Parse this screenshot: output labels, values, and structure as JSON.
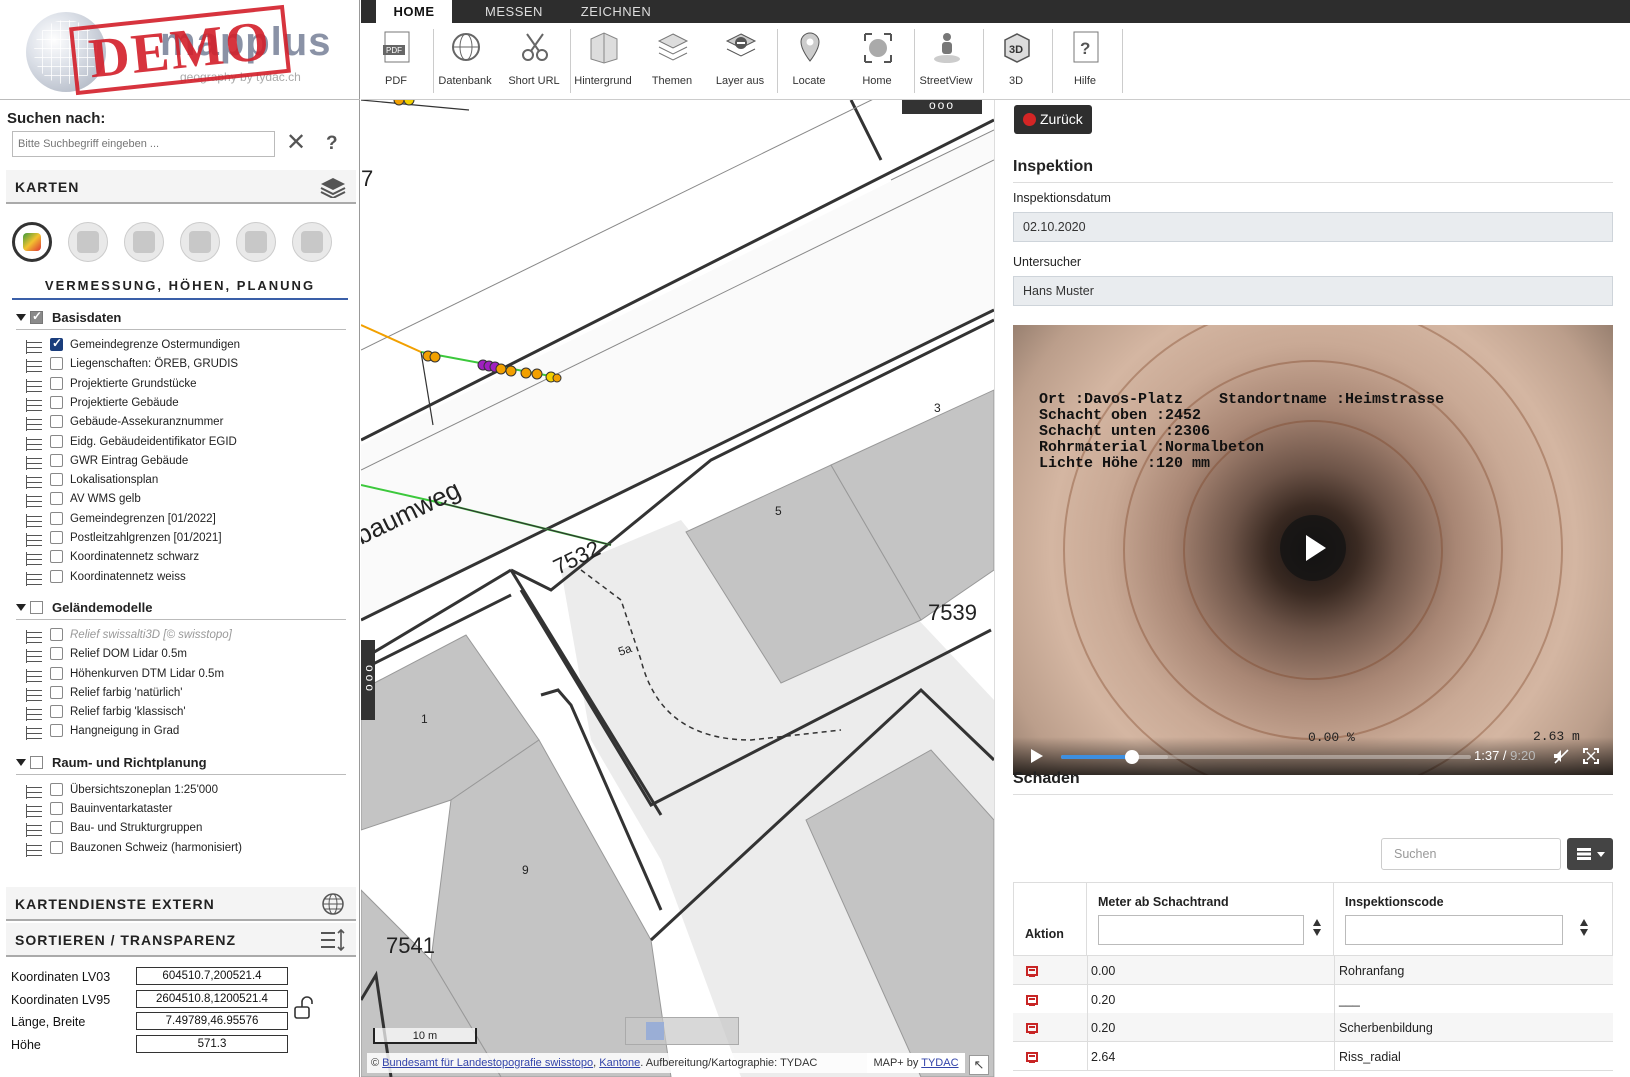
{
  "logo": {
    "brand": "mapplus",
    "brand_sub": "geography by tydac.ch",
    "stamp": "DEMO"
  },
  "search": {
    "label": "Suchen nach:",
    "placeholder": "Bitte Suchbegriff eingeben ...",
    "clear_icon": "close-icon",
    "help": "?"
  },
  "sections": {
    "karten": "KARTEN",
    "kartendienste": "KARTENDIENSTE EXTERN",
    "sortieren": "SORTIEREN / TRANSPARENZ"
  },
  "category_title": "VERMESSUNG, HÖHEN, PLANUNG",
  "layer_groups": [
    {
      "label": "Basisdaten",
      "checked": true,
      "layers": [
        {
          "label": "Gemeindegrenze Ostermundigen",
          "checked": true
        },
        {
          "label": "Liegenschaften: ÖREB, GRUDIS"
        },
        {
          "label": "Projektierte Grundstücke"
        },
        {
          "label": "Projektierte Gebäude"
        },
        {
          "label": "Gebäude-Assekuranznummer"
        },
        {
          "label": "Eidg. Gebäudeidentifikator EGID"
        },
        {
          "label": "GWR Eintrag Gebäude"
        },
        {
          "label": "Lokalisationsplan"
        },
        {
          "label": "AV WMS gelb"
        },
        {
          "label": "Gemeindegrenzen [01/2022]"
        },
        {
          "label": "Postleitzahlgrenzen [01/2021]"
        },
        {
          "label": "Koordinatennetz schwarz"
        },
        {
          "label": "Koordinatennetz weiss"
        }
      ]
    },
    {
      "label": "Geländemodelle",
      "checked": false,
      "layers": [
        {
          "label": "Relief swissalti3D [© swisstopo]",
          "disabled": true
        },
        {
          "label": "Relief DOM Lidar 0.5m"
        },
        {
          "label": "Höhenkurven DTM Lidar 0.5m"
        },
        {
          "label": "Relief farbig 'natürlich'"
        },
        {
          "label": "Relief farbig 'klassisch'"
        },
        {
          "label": "Hangneigung in Grad"
        }
      ]
    },
    {
      "label": "Raum- und Richtplanung",
      "checked": false,
      "layers": [
        {
          "label": "Übersichtszoneplan 1:25'000"
        },
        {
          "label": "Bauinventarkataster"
        },
        {
          "label": "Bau- und Strukturgruppen"
        },
        {
          "label": "Bauzonen Schweiz (harmonisiert)"
        }
      ]
    }
  ],
  "coordinates": [
    {
      "label": "Koordinaten LV03",
      "value": "604510.7,200521.4"
    },
    {
      "label": "Koordinaten LV95",
      "value": "2604510.8,1200521.4"
    },
    {
      "label": "Länge, Breite",
      "value": "7.49789,46.95576"
    },
    {
      "label": "Höhe",
      "value": "571.3"
    }
  ],
  "tabs": [
    "HOME",
    "MESSEN",
    "ZEICHNEN"
  ],
  "tools": [
    {
      "label": "PDF",
      "icon": "pdf-icon"
    },
    {
      "label": "Datenbank",
      "icon": "database-icon"
    },
    {
      "label": "Short URL",
      "icon": "scissors-icon"
    },
    {
      "label": "Hintergrund",
      "icon": "background-icon"
    },
    {
      "label": "Themen",
      "icon": "themes-icon"
    },
    {
      "label": "Layer aus",
      "icon": "layers-off-icon"
    },
    {
      "label": "Locate",
      "icon": "locate-icon"
    },
    {
      "label": "Home",
      "icon": "home-icon"
    },
    {
      "label": "StreetView",
      "icon": "streetview-icon"
    },
    {
      "label": "3D",
      "icon": "3d-icon"
    },
    {
      "label": "Hilfe",
      "icon": "help-icon"
    }
  ],
  "map": {
    "labels": [
      "7",
      "baumweg",
      "7532",
      "5",
      "3",
      "5a",
      "1",
      "9",
      "7539",
      "7541"
    ],
    "scale": "10 m",
    "attribution_prefix": "©",
    "attribution_link1": "Bundesamt für Landestopografie swisstopo",
    "attribution_sep": ",",
    "attribution_link2": "Kantone",
    "attribution_suffix": ". Aufbereitung/Kartographie: TYDAC",
    "mapplus_prefix": "MAP+ by",
    "mapplus_link": "TYDAC",
    "dots": "ooo"
  },
  "detail": {
    "back": "Zurück",
    "inspection_heading": "Inspektion",
    "date_label": "Inspektionsdatum",
    "date_value": "02.10.2020",
    "inspector_label": "Untersucher",
    "inspector_value": "Hans Muster",
    "video": {
      "overlay": "Ort :Davos-Platz    Standortname :Heimstrasse\nSchacht oben :2452\nSchacht unten :2306\nRohrmaterial :Normalbeton\nLichte Höhe :120 mm",
      "overlay_bottom1": "0.00 %",
      "overlay_bottom2": "2.63 m",
      "current": "1:37",
      "duration": "9:20",
      "progress": 0.173,
      "buffered": 0.26
    },
    "damage_heading": "Schaden",
    "table_search_placeholder": "Suchen",
    "columns": [
      "Aktion",
      "Meter ab Schachtrand",
      "Inspektionscode"
    ],
    "rows": [
      {
        "meter": "0.00",
        "code": "Rohranfang"
      },
      {
        "meter": "0.20",
        "code": "___"
      },
      {
        "meter": "0.20",
        "code": "Scherbenbildung"
      },
      {
        "meter": "2.64",
        "code": "Riss_radial"
      }
    ]
  }
}
